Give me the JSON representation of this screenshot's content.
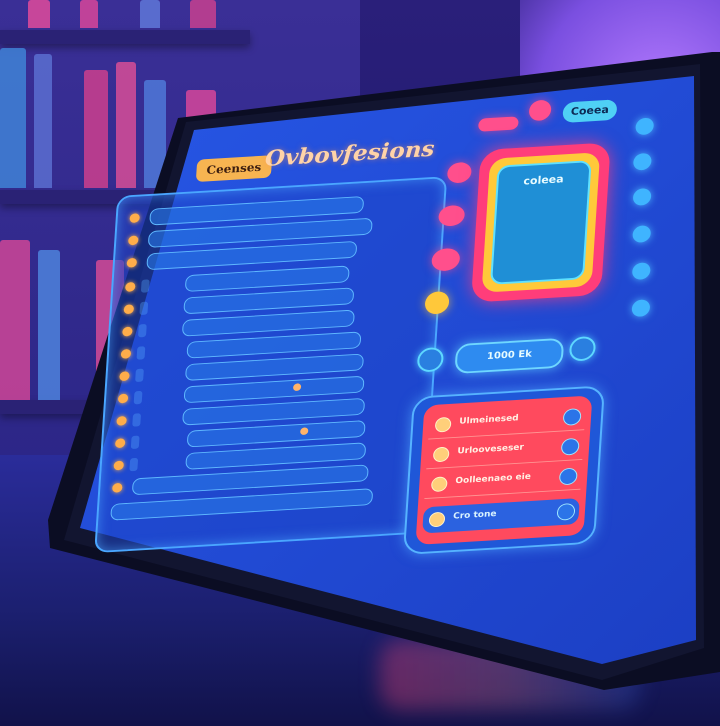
{
  "app": {
    "brand_label": "Ceenses",
    "title": "Ovbovfesions",
    "corner_label": "Coeea"
  },
  "list": {
    "rows": [
      {
        "label": "",
        "value": ""
      },
      {
        "label": "",
        "value": ""
      },
      {
        "label": "",
        "value": ""
      },
      {
        "label": "",
        "value": ""
      },
      {
        "label": "",
        "value": ""
      },
      {
        "label": "",
        "value": ""
      },
      {
        "label": "",
        "value": ""
      },
      {
        "label": "",
        "value": ""
      },
      {
        "label": "",
        "value": ""
      },
      {
        "label": "",
        "value": ""
      },
      {
        "label": "",
        "value": ""
      },
      {
        "label": "",
        "value": ""
      },
      {
        "label": "",
        "value": ""
      },
      {
        "label": "",
        "value": ""
      }
    ]
  },
  "display": {
    "title": "coleea",
    "lines": [
      "",
      "",
      "",
      ""
    ]
  },
  "action": {
    "label": "1000 Ek"
  },
  "menu": {
    "items": [
      {
        "label": "Ulmeinesed"
      },
      {
        "label": "Urlooveseser"
      },
      {
        "label": "Oolleenaeo eie"
      },
      {
        "label": "Cro tone"
      }
    ]
  },
  "colors": {
    "accent_orange": "#ffad4a",
    "panel_blue": "#1f57d8",
    "menu_red": "#ff4a5e",
    "display_pink": "#ff3d7a",
    "display_yellow": "#ffc93a"
  },
  "icons": {
    "menu_item_icon": "circle-icon",
    "menu_item_action": "circle-button-icon"
  }
}
